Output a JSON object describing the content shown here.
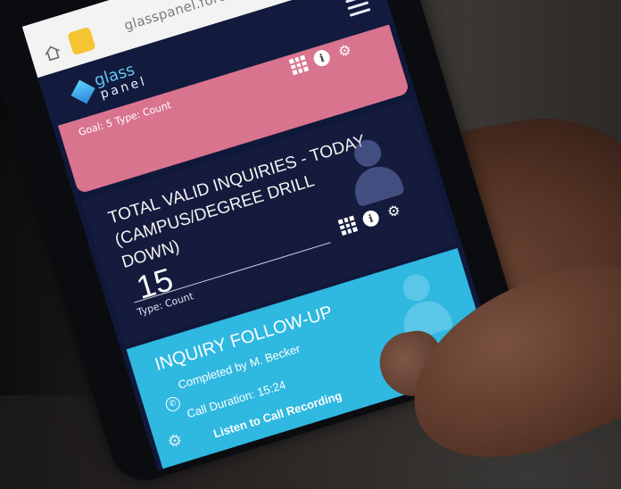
{
  "browser": {
    "url": "glasspanel.force.com"
  },
  "app": {
    "logo_line1": "glass",
    "logo_line2": "panel"
  },
  "pink_card": {
    "subtitle": "Goal: 5  Type: Count"
  },
  "inquiries_card": {
    "title": "TOTAL VALID INQUIRIES - TODAY (CAMPUS/DEGREE DRILL DOWN)",
    "value": "15",
    "subtitle": "Type: Count"
  },
  "followup_card": {
    "title": "INQUIRY FOLLOW-UP",
    "completed_by": "Completed by M. Becker",
    "call_duration": "Call Duration: 15:24",
    "link": "Listen to Call Recording"
  },
  "colors": {
    "pink": "#d9748f",
    "dark_navy": "#151b3c",
    "cyan": "#2fb8e0",
    "logo_blue": "#62c7f2"
  },
  "icons": [
    "home-icon",
    "tab-icon",
    "menu-icon",
    "grid-icon",
    "info-icon",
    "gear-icon",
    "person-icon",
    "phone-icon"
  ]
}
